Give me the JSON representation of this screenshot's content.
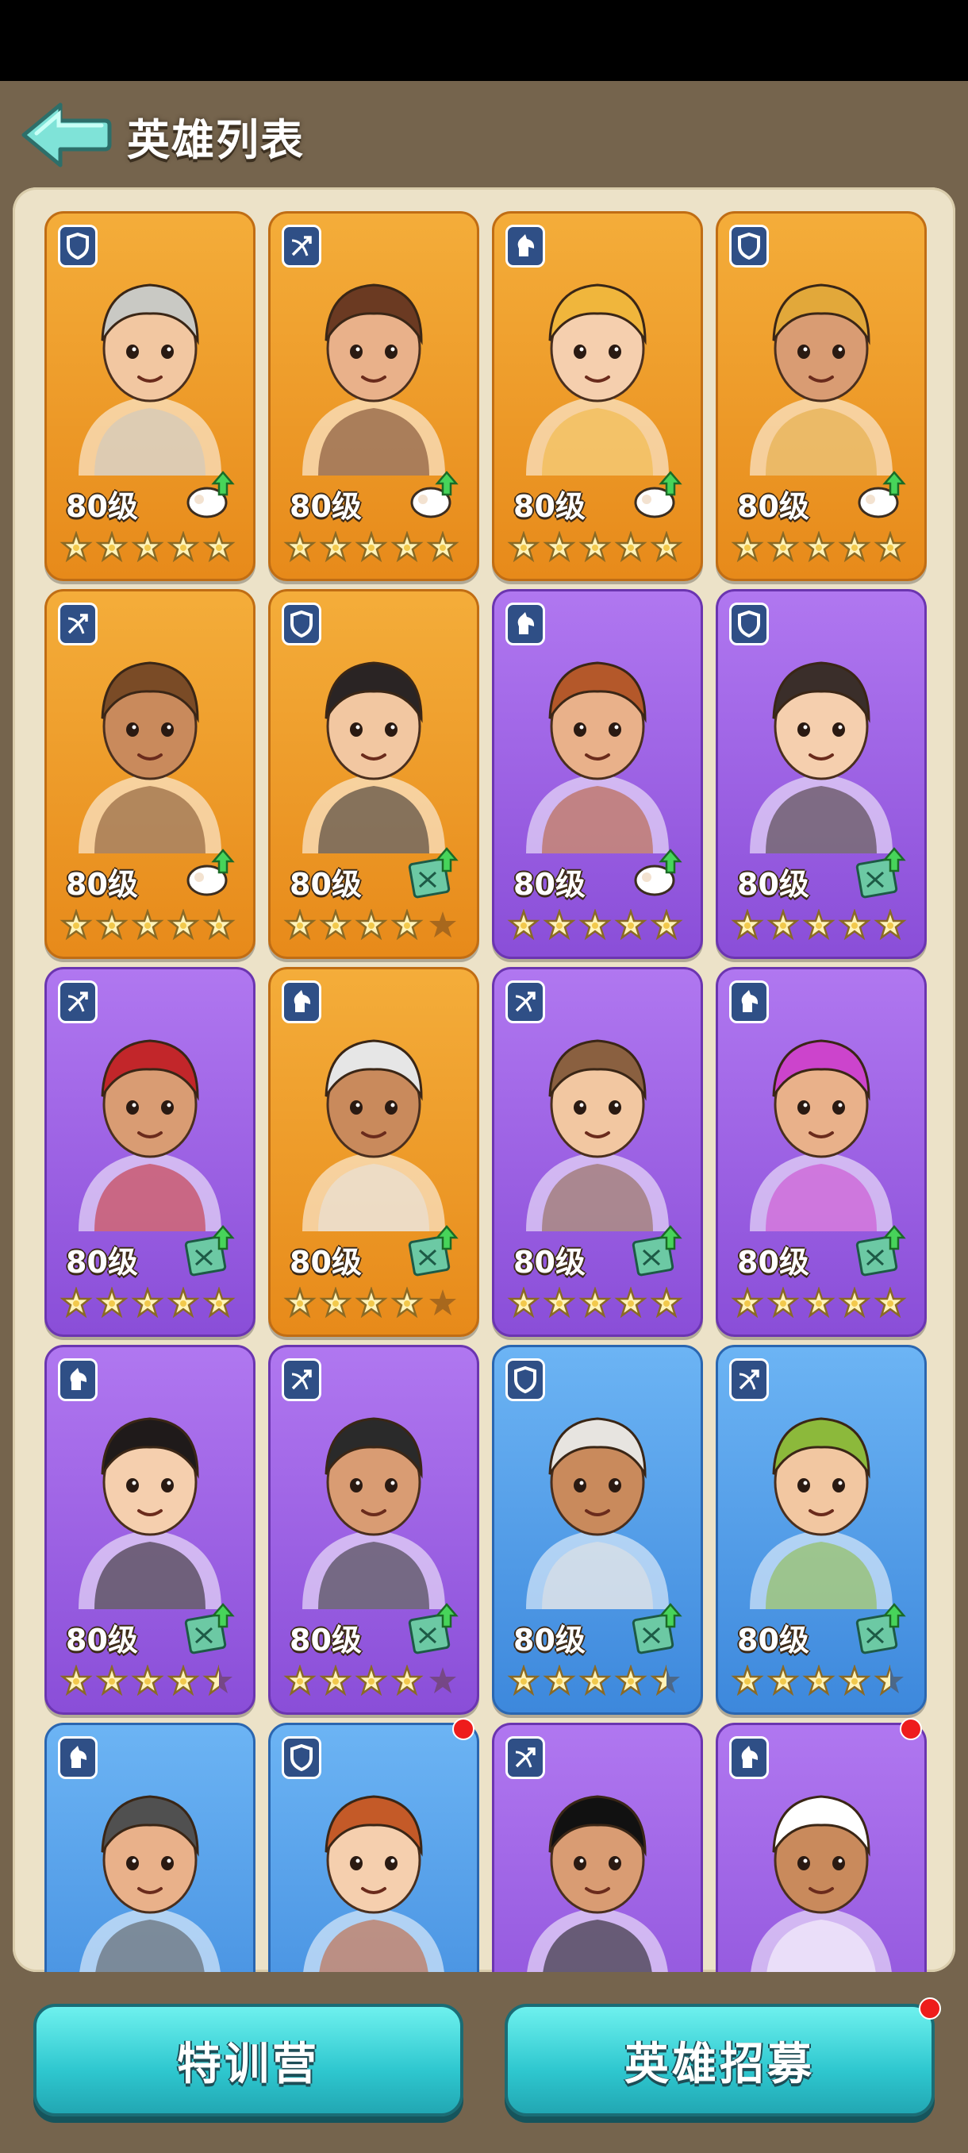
{
  "header": {
    "title": "英雄列表",
    "back_icon": "back-arrow-icon"
  },
  "colors": {
    "orange": "#f4ad3a",
    "purple": "#a86cec",
    "blue": "#5aa4ef",
    "teal_button": "#3fd8dc",
    "background": "#75644d",
    "panel": "#ece2c8"
  },
  "heroes": [
    {
      "class_icon": "shield-icon",
      "color": "orange",
      "level": "80级",
      "upgrade_icon": "sheep-upgrade-icon",
      "stars": 5,
      "reddot": false
    },
    {
      "class_icon": "bow-icon",
      "color": "orange",
      "level": "80级",
      "upgrade_icon": "sheep-upgrade-icon",
      "stars": 5,
      "reddot": false
    },
    {
      "class_icon": "horse-icon",
      "color": "orange",
      "level": "80级",
      "upgrade_icon": "sheep-upgrade-icon",
      "stars": 5,
      "reddot": false
    },
    {
      "class_icon": "shield-icon",
      "color": "orange",
      "level": "80级",
      "upgrade_icon": "sheep-upgrade-icon",
      "stars": 5,
      "reddot": false
    },
    {
      "class_icon": "bow-icon",
      "color": "orange",
      "level": "80级",
      "upgrade_icon": "sheep-upgrade-icon",
      "stars": 5,
      "reddot": false
    },
    {
      "class_icon": "shield-icon",
      "color": "orange",
      "level": "80级",
      "upgrade_icon": "book-upgrade-icon",
      "stars": 4,
      "reddot": false
    },
    {
      "class_icon": "horse-icon",
      "color": "purple",
      "level": "80级",
      "upgrade_icon": "sheep-upgrade-icon",
      "stars": 5,
      "reddot": false
    },
    {
      "class_icon": "shield-icon",
      "color": "purple",
      "level": "80级",
      "upgrade_icon": "book-upgrade-icon",
      "stars": 5,
      "reddot": false
    },
    {
      "class_icon": "bow-icon",
      "color": "purple",
      "level": "80级",
      "upgrade_icon": "book-upgrade-icon",
      "stars": 5,
      "reddot": false
    },
    {
      "class_icon": "horse-icon",
      "color": "orange",
      "level": "80级",
      "upgrade_icon": "book-upgrade-icon",
      "stars": 4,
      "reddot": false
    },
    {
      "class_icon": "bow-icon",
      "color": "purple",
      "level": "80级",
      "upgrade_icon": "book-upgrade-icon",
      "stars": 5,
      "reddot": false
    },
    {
      "class_icon": "horse-icon",
      "color": "purple",
      "level": "80级",
      "upgrade_icon": "book-upgrade-icon",
      "stars": 5,
      "reddot": false
    },
    {
      "class_icon": "horse-icon",
      "color": "purple",
      "level": "80级",
      "upgrade_icon": "book-upgrade-icon",
      "stars": 4.5,
      "reddot": false
    },
    {
      "class_icon": "bow-icon",
      "color": "purple",
      "level": "80级",
      "upgrade_icon": "book-upgrade-icon",
      "stars": 4,
      "reddot": false
    },
    {
      "class_icon": "shield-icon",
      "color": "blue",
      "level": "80级",
      "upgrade_icon": "book-upgrade-icon",
      "stars": 4.5,
      "reddot": false
    },
    {
      "class_icon": "bow-icon",
      "color": "blue",
      "level": "80级",
      "upgrade_icon": "book-upgrade-icon",
      "stars": 4.5,
      "reddot": false
    },
    {
      "class_icon": "horse-icon",
      "color": "blue",
      "level": "",
      "upgrade_icon": "",
      "stars": 0,
      "reddot": false
    },
    {
      "class_icon": "shield-icon",
      "color": "blue",
      "level": "",
      "upgrade_icon": "",
      "stars": 0,
      "reddot": true
    },
    {
      "class_icon": "bow-icon",
      "color": "purple",
      "level": "",
      "upgrade_icon": "",
      "stars": 0,
      "reddot": false
    },
    {
      "class_icon": "horse-icon",
      "color": "purple",
      "level": "",
      "upgrade_icon": "",
      "stars": 0,
      "reddot": true
    }
  ],
  "buttons": {
    "training": "特训营",
    "recruit": "英雄招募",
    "recruit_reddot": true
  }
}
